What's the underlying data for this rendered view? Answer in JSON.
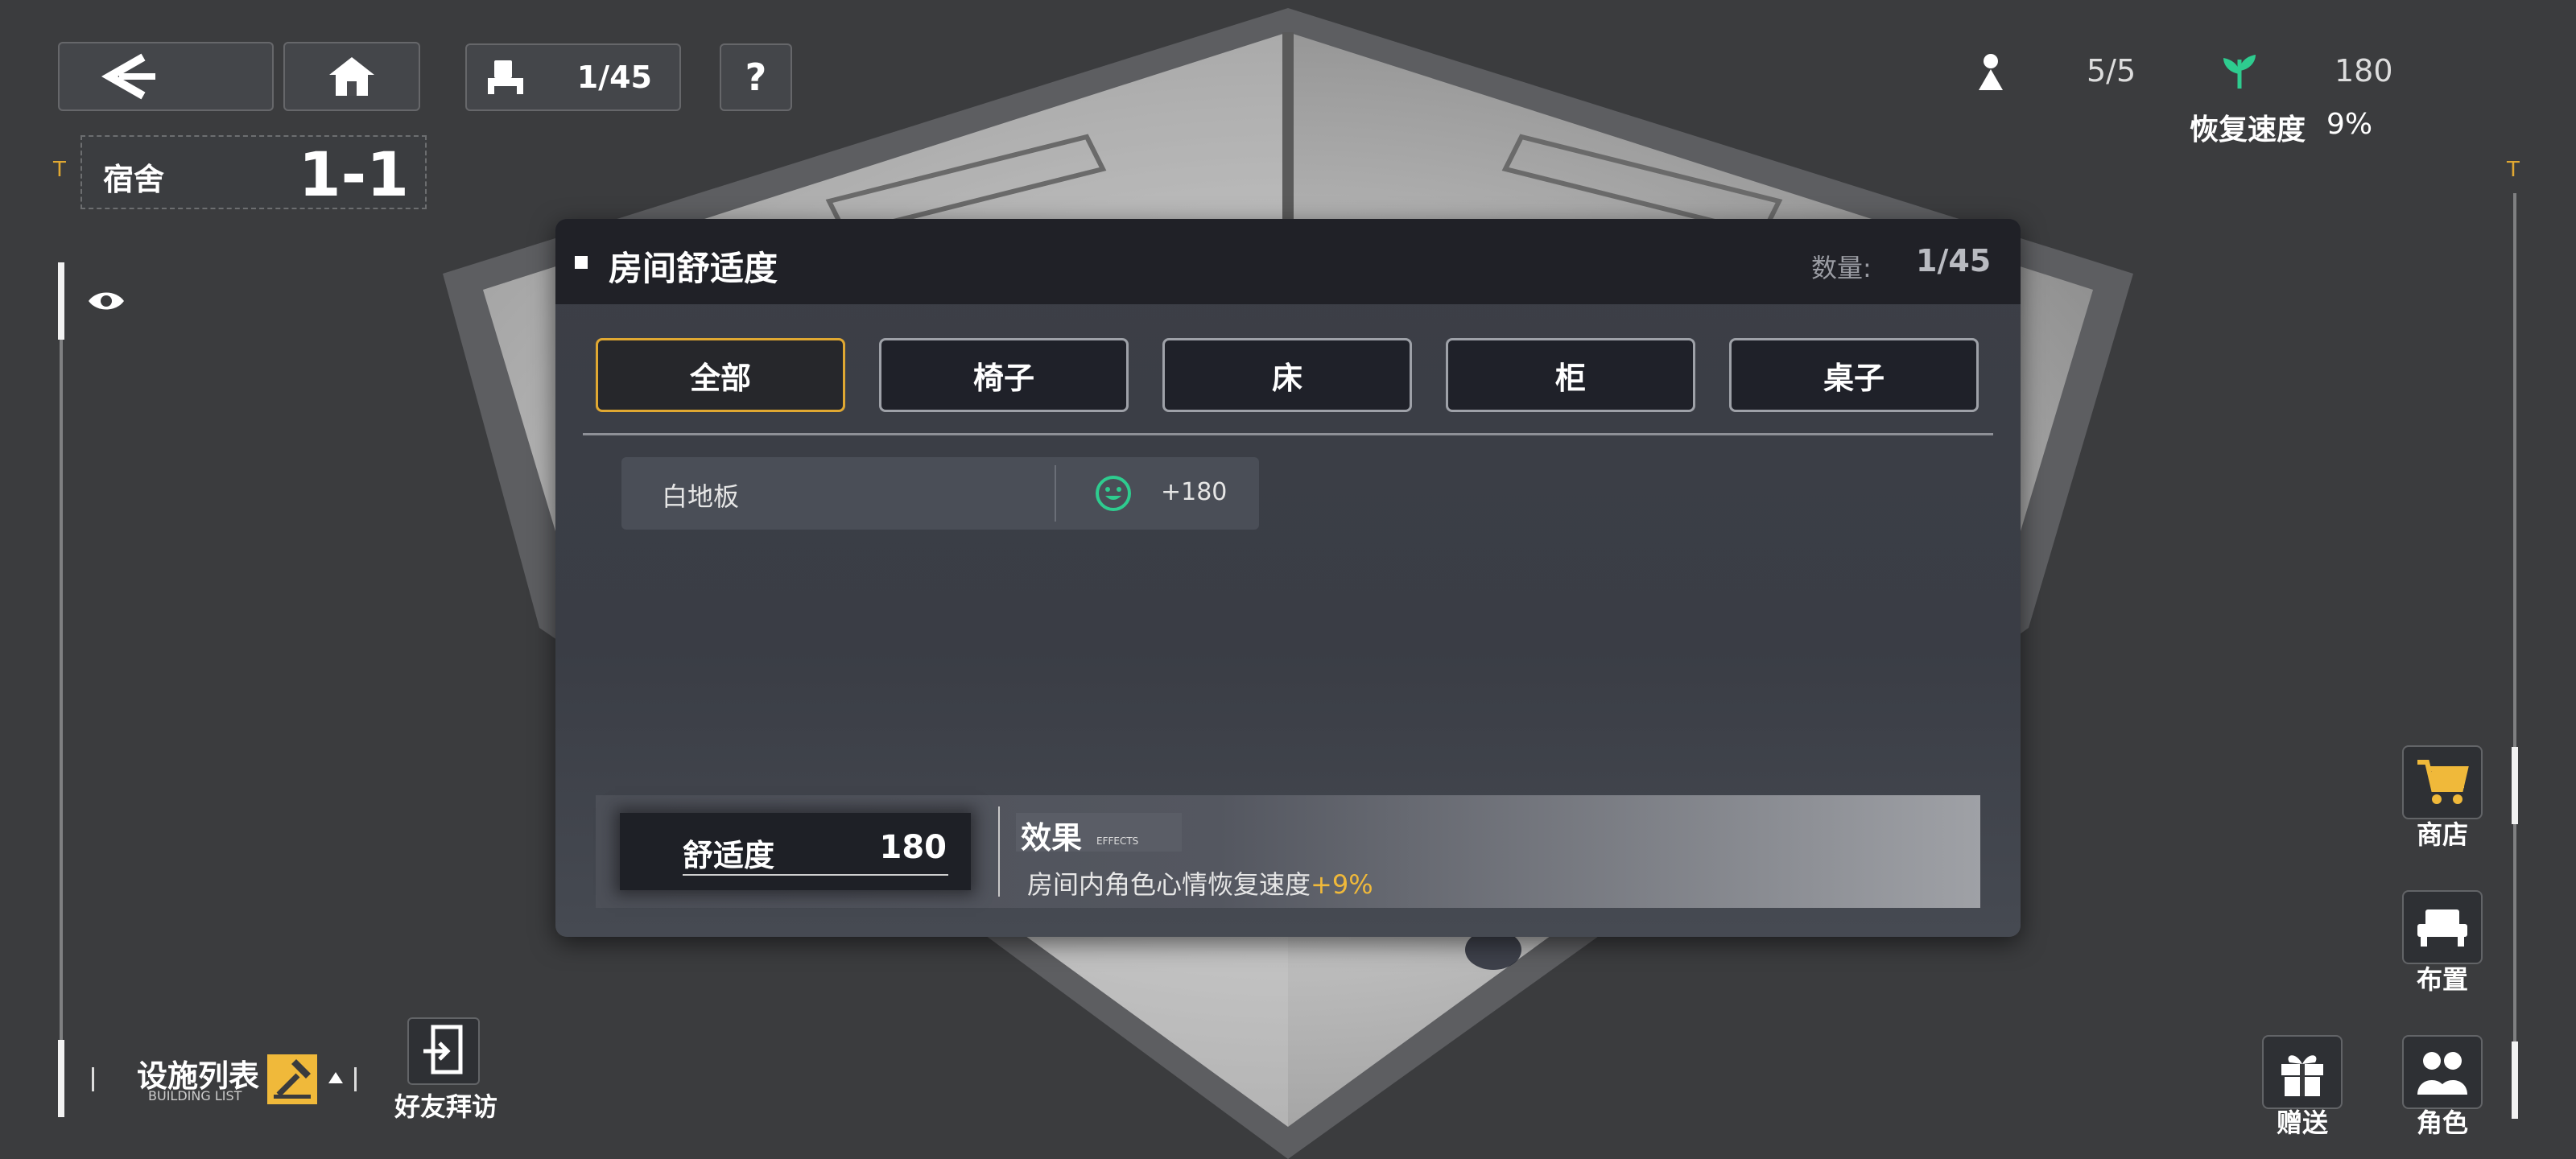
{
  "hud": {
    "furniture_count": "1/45",
    "help_glyph": "?",
    "residents": "5/5",
    "comfort_value": "180",
    "recovery_label": "恢复速度",
    "recovery_value": "9%"
  },
  "dorm": {
    "label": "宿舍",
    "number": "1-1"
  },
  "modal": {
    "title": "房间舒适度",
    "count_label": "数量:",
    "count_value": "1/45",
    "tabs": [
      {
        "label": "全部",
        "active": true
      },
      {
        "label": "椅子",
        "active": false
      },
      {
        "label": "床",
        "active": false
      },
      {
        "label": "柜",
        "active": false
      },
      {
        "label": "桌子",
        "active": false
      }
    ],
    "items": [
      {
        "name": "白地板",
        "bonus": "+180"
      }
    ],
    "footer": {
      "comfort_label": "舒适度",
      "comfort_value": "180",
      "effects_label": "效果",
      "effects_sub": "EFFECTS",
      "effect_text": "房间内角色心情恢复速度",
      "effect_value": "+9%"
    }
  },
  "bottom": {
    "building_list_label": "设施列表",
    "building_list_sub": "BUILDING LIST",
    "friend_visit": "好友拜访",
    "gift": "赠送",
    "character": "角色"
  },
  "side": {
    "shop": "商店",
    "layout": "布置"
  },
  "colors": {
    "accent_gold": "#e0a832",
    "accent_green": "#2ecc8f",
    "effect_value": "#f0b93a"
  }
}
